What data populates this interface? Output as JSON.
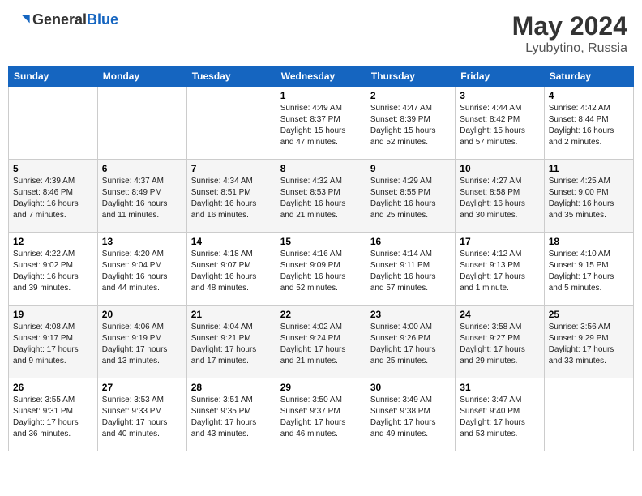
{
  "header": {
    "logo": {
      "text_general": "General",
      "text_blue": "Blue"
    },
    "title": "May 2024",
    "location": "Lyubytino, Russia"
  },
  "days_of_week": [
    "Sunday",
    "Monday",
    "Tuesday",
    "Wednesday",
    "Thursday",
    "Friday",
    "Saturday"
  ],
  "weeks": [
    [
      {
        "day": "",
        "info": ""
      },
      {
        "day": "",
        "info": ""
      },
      {
        "day": "",
        "info": ""
      },
      {
        "day": "1",
        "info": "Sunrise: 4:49 AM\nSunset: 8:37 PM\nDaylight: 15 hours\nand 47 minutes."
      },
      {
        "day": "2",
        "info": "Sunrise: 4:47 AM\nSunset: 8:39 PM\nDaylight: 15 hours\nand 52 minutes."
      },
      {
        "day": "3",
        "info": "Sunrise: 4:44 AM\nSunset: 8:42 PM\nDaylight: 15 hours\nand 57 minutes."
      },
      {
        "day": "4",
        "info": "Sunrise: 4:42 AM\nSunset: 8:44 PM\nDaylight: 16 hours\nand 2 minutes."
      }
    ],
    [
      {
        "day": "5",
        "info": "Sunrise: 4:39 AM\nSunset: 8:46 PM\nDaylight: 16 hours\nand 7 minutes."
      },
      {
        "day": "6",
        "info": "Sunrise: 4:37 AM\nSunset: 8:49 PM\nDaylight: 16 hours\nand 11 minutes."
      },
      {
        "day": "7",
        "info": "Sunrise: 4:34 AM\nSunset: 8:51 PM\nDaylight: 16 hours\nand 16 minutes."
      },
      {
        "day": "8",
        "info": "Sunrise: 4:32 AM\nSunset: 8:53 PM\nDaylight: 16 hours\nand 21 minutes."
      },
      {
        "day": "9",
        "info": "Sunrise: 4:29 AM\nSunset: 8:55 PM\nDaylight: 16 hours\nand 25 minutes."
      },
      {
        "day": "10",
        "info": "Sunrise: 4:27 AM\nSunset: 8:58 PM\nDaylight: 16 hours\nand 30 minutes."
      },
      {
        "day": "11",
        "info": "Sunrise: 4:25 AM\nSunset: 9:00 PM\nDaylight: 16 hours\nand 35 minutes."
      }
    ],
    [
      {
        "day": "12",
        "info": "Sunrise: 4:22 AM\nSunset: 9:02 PM\nDaylight: 16 hours\nand 39 minutes."
      },
      {
        "day": "13",
        "info": "Sunrise: 4:20 AM\nSunset: 9:04 PM\nDaylight: 16 hours\nand 44 minutes."
      },
      {
        "day": "14",
        "info": "Sunrise: 4:18 AM\nSunset: 9:07 PM\nDaylight: 16 hours\nand 48 minutes."
      },
      {
        "day": "15",
        "info": "Sunrise: 4:16 AM\nSunset: 9:09 PM\nDaylight: 16 hours\nand 52 minutes."
      },
      {
        "day": "16",
        "info": "Sunrise: 4:14 AM\nSunset: 9:11 PM\nDaylight: 16 hours\nand 57 minutes."
      },
      {
        "day": "17",
        "info": "Sunrise: 4:12 AM\nSunset: 9:13 PM\nDaylight: 17 hours\nand 1 minute."
      },
      {
        "day": "18",
        "info": "Sunrise: 4:10 AM\nSunset: 9:15 PM\nDaylight: 17 hours\nand 5 minutes."
      }
    ],
    [
      {
        "day": "19",
        "info": "Sunrise: 4:08 AM\nSunset: 9:17 PM\nDaylight: 17 hours\nand 9 minutes."
      },
      {
        "day": "20",
        "info": "Sunrise: 4:06 AM\nSunset: 9:19 PM\nDaylight: 17 hours\nand 13 minutes."
      },
      {
        "day": "21",
        "info": "Sunrise: 4:04 AM\nSunset: 9:21 PM\nDaylight: 17 hours\nand 17 minutes."
      },
      {
        "day": "22",
        "info": "Sunrise: 4:02 AM\nSunset: 9:24 PM\nDaylight: 17 hours\nand 21 minutes."
      },
      {
        "day": "23",
        "info": "Sunrise: 4:00 AM\nSunset: 9:26 PM\nDaylight: 17 hours\nand 25 minutes."
      },
      {
        "day": "24",
        "info": "Sunrise: 3:58 AM\nSunset: 9:27 PM\nDaylight: 17 hours\nand 29 minutes."
      },
      {
        "day": "25",
        "info": "Sunrise: 3:56 AM\nSunset: 9:29 PM\nDaylight: 17 hours\nand 33 minutes."
      }
    ],
    [
      {
        "day": "26",
        "info": "Sunrise: 3:55 AM\nSunset: 9:31 PM\nDaylight: 17 hours\nand 36 minutes."
      },
      {
        "day": "27",
        "info": "Sunrise: 3:53 AM\nSunset: 9:33 PM\nDaylight: 17 hours\nand 40 minutes."
      },
      {
        "day": "28",
        "info": "Sunrise: 3:51 AM\nSunset: 9:35 PM\nDaylight: 17 hours\nand 43 minutes."
      },
      {
        "day": "29",
        "info": "Sunrise: 3:50 AM\nSunset: 9:37 PM\nDaylight: 17 hours\nand 46 minutes."
      },
      {
        "day": "30",
        "info": "Sunrise: 3:49 AM\nSunset: 9:38 PM\nDaylight: 17 hours\nand 49 minutes."
      },
      {
        "day": "31",
        "info": "Sunrise: 3:47 AM\nSunset: 9:40 PM\nDaylight: 17 hours\nand 53 minutes."
      },
      {
        "day": "",
        "info": ""
      }
    ]
  ]
}
